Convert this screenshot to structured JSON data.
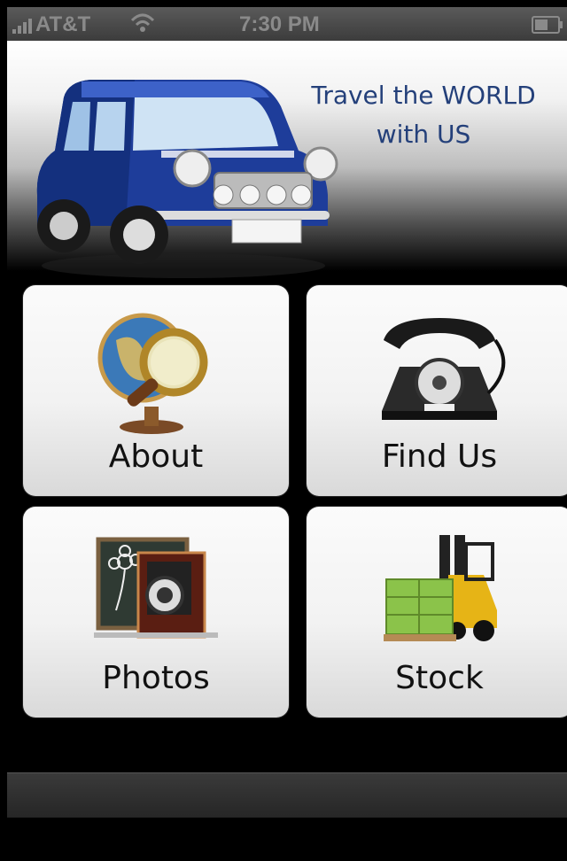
{
  "status_bar": {
    "carrier": "AT&T",
    "time": "7:30 PM",
    "signal_icon": "signal-bars-icon",
    "wifi_icon": "wifi-icon",
    "battery_icon": "battery-icon"
  },
  "header": {
    "tagline_line1": "Travel the WORLD",
    "tagline_line2": "with US",
    "image": "blue-mini-car-image",
    "tagline_color": "#24407a"
  },
  "menu": {
    "items": [
      {
        "label": "About",
        "icon": "globe-magnifier-icon"
      },
      {
        "label": "Find Us",
        "icon": "rotary-phone-icon"
      },
      {
        "label": "Photos",
        "icon": "camera-chalkboard-icon"
      },
      {
        "label": "Stock",
        "icon": "forklift-pallet-icon"
      }
    ]
  }
}
